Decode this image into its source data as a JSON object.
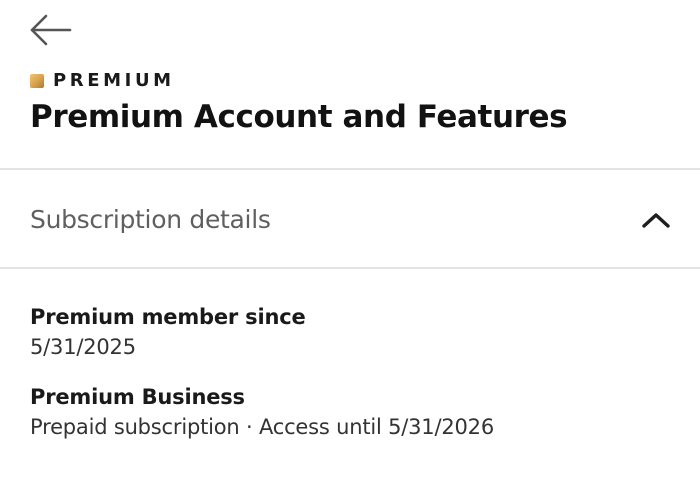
{
  "header": {
    "back_icon": "arrow-left-icon",
    "brand_label": "PREMIUM",
    "brand_badge_color": "#d6a04d",
    "title": "Premium Account and Features"
  },
  "section": {
    "title": "Subscription details",
    "expanded": true,
    "toggle_icon": "chevron-up-icon"
  },
  "details": [
    {
      "heading": "Premium member since",
      "value": "5/31/2025"
    },
    {
      "heading": "Premium Business",
      "value": "Prepaid subscription · Access until 5/31/2026"
    }
  ],
  "colors": {
    "text_primary": "#121212",
    "text_secondary": "#5f5f5f",
    "divider": "#e3e3e3",
    "background": "#ffffff"
  }
}
